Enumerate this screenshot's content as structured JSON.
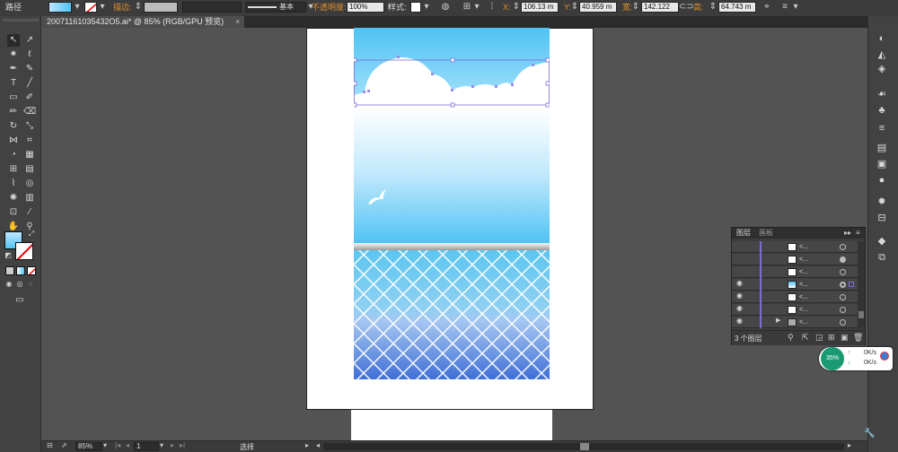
{
  "control_bar": {
    "object_type": "路径",
    "stroke_label": "描边:",
    "stroke_profile": "基本",
    "opacity_label": "不透明度:",
    "opacity_value": "100%",
    "style_label": "样式:",
    "x_label": "X:",
    "x_value": "106.13 m",
    "y_label": "Y:",
    "y_value": "40.959 m",
    "w_label": "宽:",
    "w_value": "142.122",
    "h_label": "高:",
    "h_value": "64.743 m"
  },
  "document_tab": {
    "title": "20071161035432O5.ai* @ 85% (RGB/GPU 预览)",
    "close": "×"
  },
  "layers_panel": {
    "tab_layers": "图层",
    "tab_artboards": "画板",
    "layer_count": "3 个图层",
    "row_name": "<...",
    "expand_arrow": "▶"
  },
  "status_bar": {
    "zoom": "85%",
    "artboard_number": "1",
    "tool_name": "选择"
  },
  "speed_widget": {
    "percent": "35%",
    "up": "0K/s",
    "down": "0K/s"
  },
  "colors": {
    "accent": "#e0902c",
    "selection": "#7b6bd6",
    "sky_top": "#4fc3f4",
    "sea_bottom": "#3f6fd6"
  }
}
